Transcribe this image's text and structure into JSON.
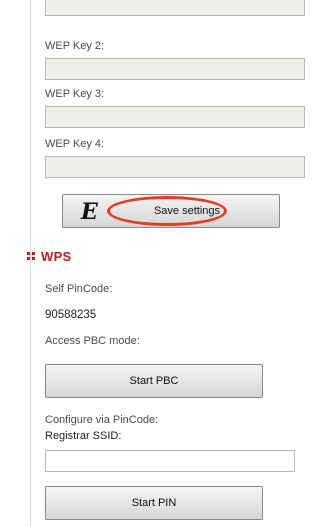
{
  "wep": {
    "key2_label": "WEP Key 2:",
    "key3_label": "WEP Key 3:",
    "key4_label": "WEP Key 4:",
    "save_button": "Save settings",
    "annotation_letter": "E"
  },
  "wps": {
    "title": "WPS",
    "self_pincode_label": "Self PinCode:",
    "self_pincode_value": "90588235",
    "access_pbc_label": "Access PBC mode:",
    "start_pbc_button": "Start PBC",
    "configure_label": "Configure via PinCode:",
    "registrar_ssid_label": "Registrar SSID:",
    "registrar_ssid_value": "",
    "start_pin_button": "Start PIN"
  },
  "colors": {
    "accent_red": "#b3261e",
    "annotation_red": "#e53d24",
    "field_bg": "#efefea"
  }
}
